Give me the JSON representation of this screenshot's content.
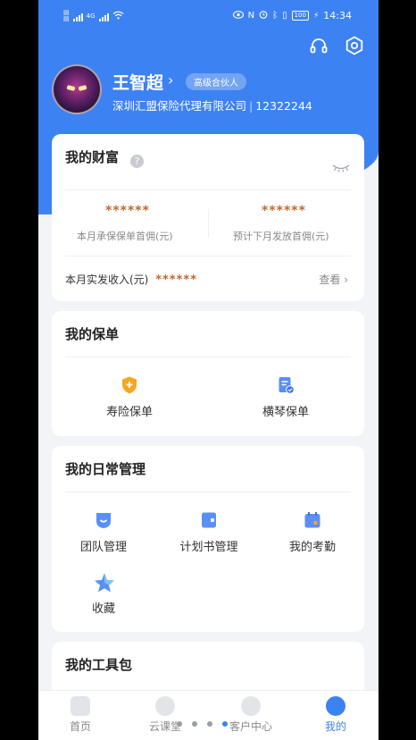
{
  "status": {
    "network_left": "4G",
    "battery": "100",
    "time": "14:34"
  },
  "profile": {
    "name": "王智超",
    "badge": "高级合伙人",
    "company": "深圳汇盟保险代理有限公司",
    "id": "12322244"
  },
  "wealth": {
    "title": "我的财富",
    "help_icon": "?",
    "commission_value": "******",
    "commission_label": "本月承保保单首佣(元)",
    "forecast_value": "******",
    "forecast_label": "预计下月发放首佣(元)",
    "income_label": "本月实发收入(元)",
    "income_value": "******",
    "view_label": "查看"
  },
  "policy": {
    "title": "我的保单",
    "items": [
      {
        "label": "寿险保单",
        "icon": "shield-plus-icon"
      },
      {
        "label": "横琴保单",
        "icon": "document-check-icon"
      }
    ]
  },
  "daily": {
    "title": "我的日常管理",
    "items": [
      {
        "label": "团队管理",
        "icon": "team-icon"
      },
      {
        "label": "计划书管理",
        "icon": "plan-book-icon"
      },
      {
        "label": "我的考勤",
        "icon": "calendar-icon"
      },
      {
        "label": "收藏",
        "icon": "star-icon"
      }
    ]
  },
  "tools": {
    "title": "我的工具包"
  },
  "tabbar": {
    "items": [
      {
        "label": "首页"
      },
      {
        "label": "云课堂"
      },
      {
        "label": "客户中心"
      },
      {
        "label": "我的"
      }
    ]
  },
  "colors": {
    "primary": "#3d82f3",
    "masked": "#c6652f",
    "icon_orange": "#f5a623"
  }
}
